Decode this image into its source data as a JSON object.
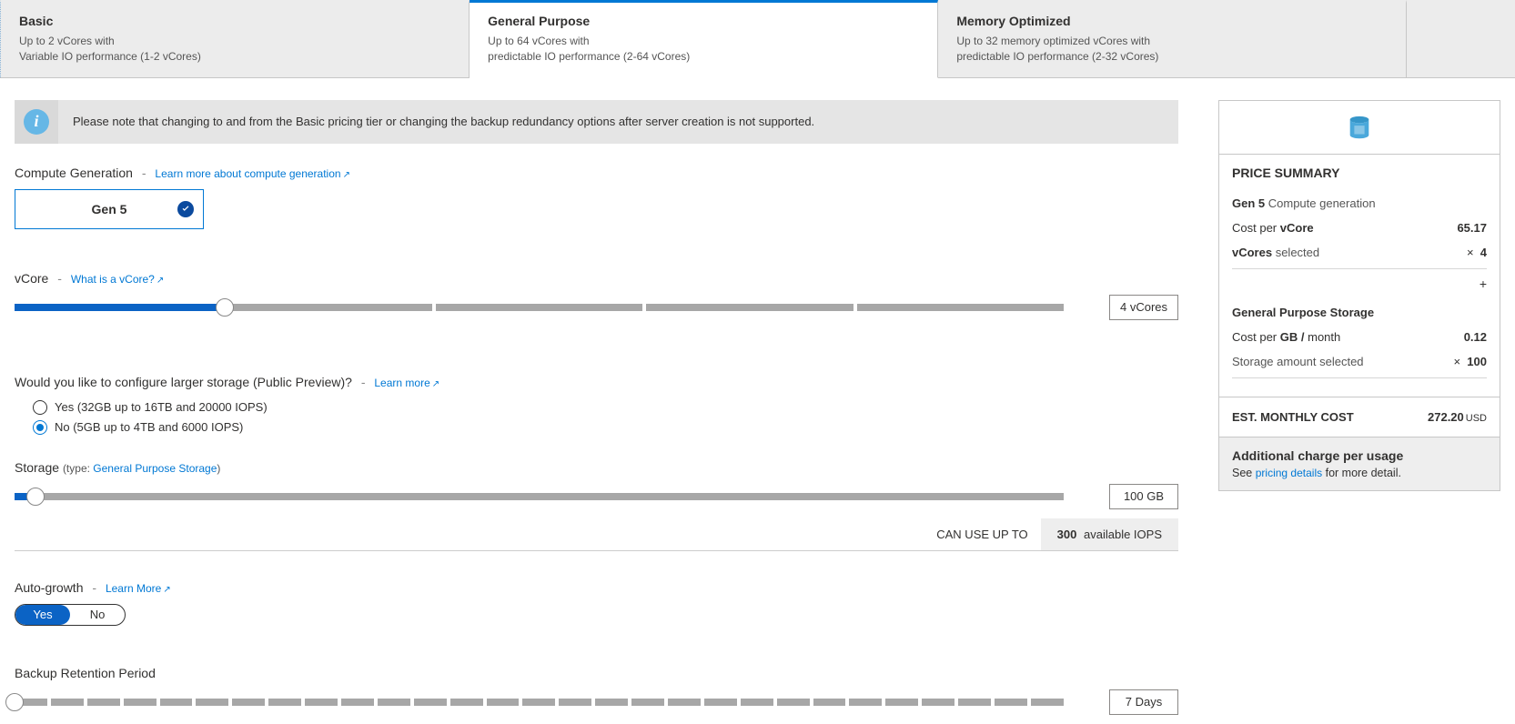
{
  "tabs": {
    "basic": {
      "title": "Basic",
      "line1": "Up to 2 vCores with",
      "line2": "Variable IO performance (1-2 vCores)"
    },
    "general": {
      "title": "General Purpose",
      "line1": "Up to 64 vCores with",
      "line2": "predictable IO performance (2-64 vCores)"
    },
    "memory": {
      "title": "Memory Optimized",
      "line1": "Up to 32 memory optimized vCores with",
      "line2": "predictable IO performance (2-32 vCores)"
    }
  },
  "info_banner": "Please note that changing to and from the Basic pricing tier or changing the backup redundancy options after server creation is not supported.",
  "compute_gen": {
    "label": "Compute Generation",
    "learn_more": "Learn more about compute generation",
    "selected": "Gen 5"
  },
  "vcore": {
    "label": "vCore",
    "help_link": "What is a vCore?",
    "value_display": "4 vCores",
    "selected_index": 1,
    "options_count": 5
  },
  "large_storage": {
    "label": "Would you like to configure larger storage (Public Preview)?",
    "learn_more": "Learn more",
    "options": {
      "yes": "Yes (32GB up to 16TB and 20000 IOPS)",
      "no": "No (5GB up to 4TB and 6000 IOPS)"
    },
    "selected": "no"
  },
  "storage": {
    "label": "Storage",
    "type_prefix": "(type:",
    "type_link": "General Purpose Storage",
    "type_suffix": ")",
    "value_display": "100 GB",
    "fill_percent": 2
  },
  "iops": {
    "left": "CAN USE UP TO",
    "value": "300",
    "suffix": "available IOPS"
  },
  "auto_growth": {
    "label": "Auto-growth",
    "learn_more": "Learn More",
    "yes": "Yes",
    "no": "No",
    "selected": "yes"
  },
  "backup": {
    "label": "Backup Retention Period",
    "value_display": "7 Days",
    "segments": 29,
    "selected_index": 0
  },
  "summary": {
    "title": "PRICE SUMMARY",
    "gen_label": "Gen 5",
    "gen_suffix": "Compute generation",
    "cost_per_vcore_label_prefix": "Cost per",
    "cost_per_vcore_label_bold": "vCore",
    "cost_per_vcore": "65.17",
    "vcores_selected_label_bold": "vCores",
    "vcores_selected_label_suffix": "selected",
    "vcores_selected_prefix": "×",
    "vcores_selected": "4",
    "plus": "+",
    "storage_head": "General Purpose Storage",
    "cost_per_gb_label_prefix": "Cost per",
    "cost_per_gb_label_bold": "GB /",
    "cost_per_gb_label_suffix": "month",
    "cost_per_gb": "0.12",
    "storage_amount_label": "Storage amount selected",
    "storage_amount_prefix": "×",
    "storage_amount": "100",
    "est_label": "EST. MONTHLY COST",
    "est_amount": "272.20",
    "est_currency": "USD",
    "addl_title": "Additional charge per usage",
    "addl_prefix": "See",
    "addl_link": "pricing details",
    "addl_suffix": "for more detail."
  }
}
